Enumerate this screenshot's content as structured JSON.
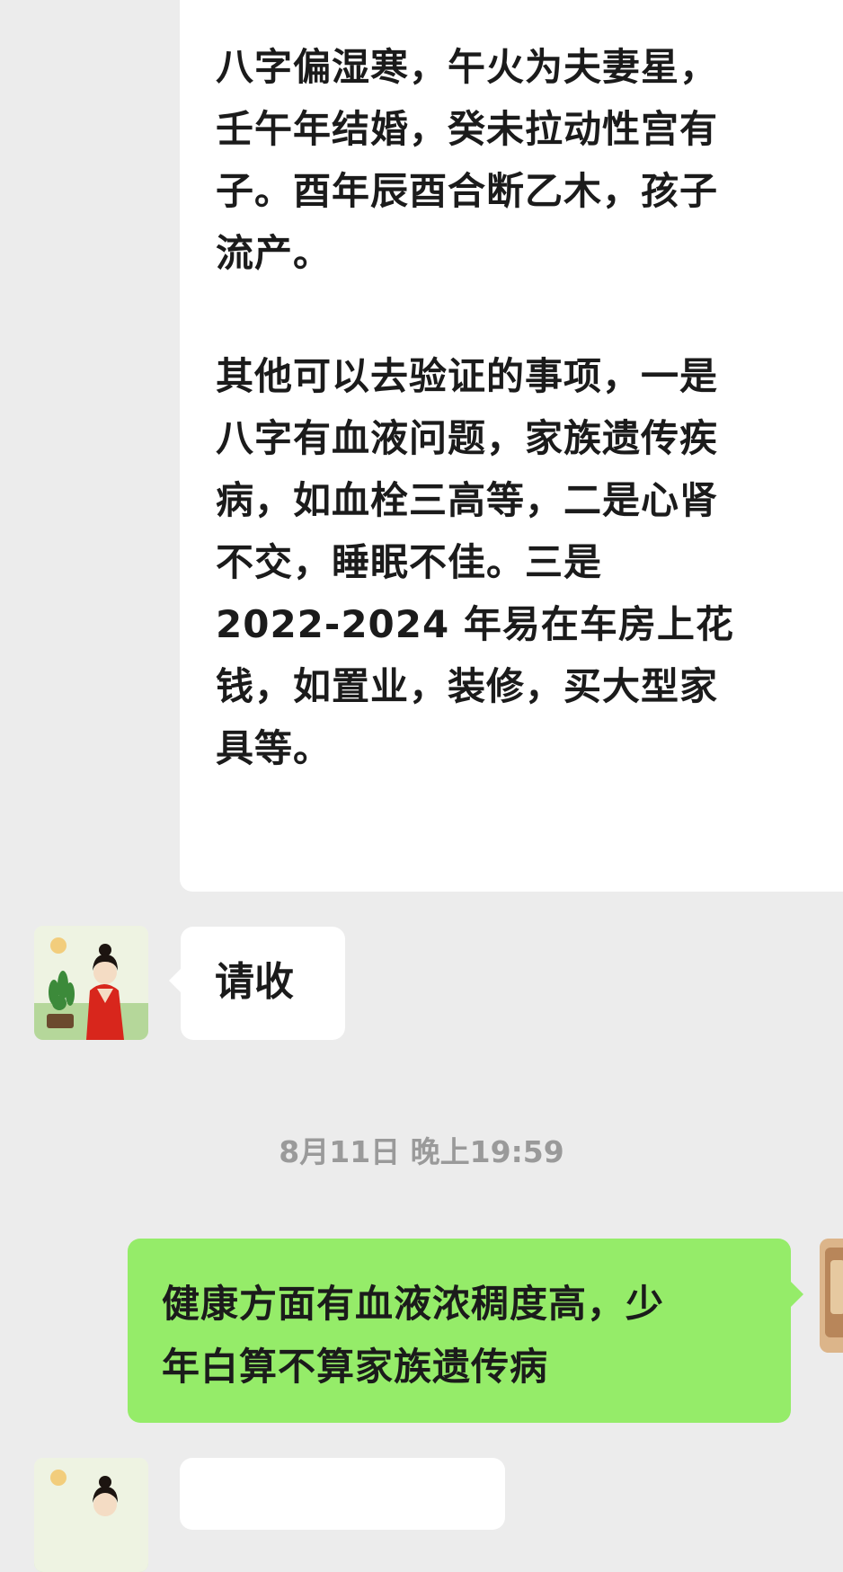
{
  "messages": [
    {
      "direction": "incoming",
      "paragraphs": [
        "八字偏湿寒，午火为夫妻星，\n壬午年结婚，癸未拉动性宫有\n子。酉年辰酉合断乙木，孩子\n流产。",
        "其他可以去验证的事项，一是\n八字有血液问题，家族遗传疾\n病，如血栓三高等，二是心肾\n不交，睡眠不佳。三是\n2022-2024 年易在车房上花\n钱，如置业，装修，买大型家\n具等。"
      ]
    },
    {
      "direction": "incoming",
      "text": "请收"
    },
    {
      "direction": "outgoing",
      "text": "健康方面有血液浓稠度高，少\n年白算不算家族遗传病"
    }
  ],
  "timestamp": "8月11日 晚上19:59",
  "colors": {
    "background": "#ececec",
    "incoming_bubble": "#ffffff",
    "outgoing_bubble": "#95ec69",
    "timestamp_text": "#9a9a9a"
  },
  "icons": {
    "contact_avatar": "avatar-woman-red-dress",
    "self_avatar": "avatar-self"
  }
}
